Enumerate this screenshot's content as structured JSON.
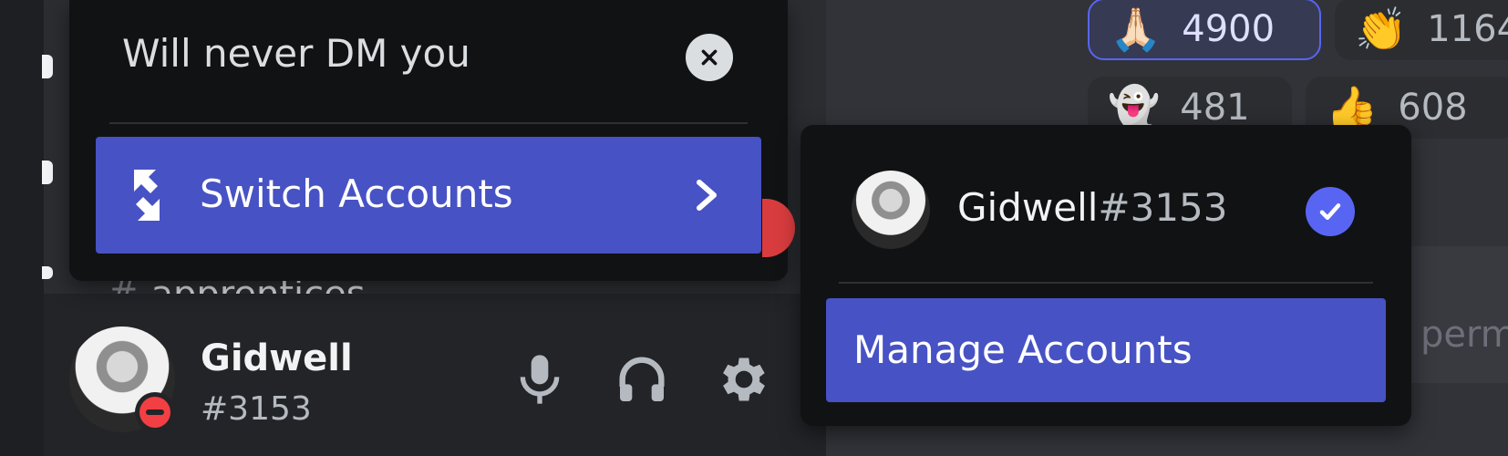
{
  "status_popout": {
    "custom_status": "Will never DM you",
    "switch_accounts_label": "Switch Accounts"
  },
  "channel_list": {
    "partial_channel_name": "apprentices"
  },
  "user_panel": {
    "username": "Gidwell",
    "discriminator": "#3153",
    "status": "do-not-disturb"
  },
  "accounts_popout": {
    "account_username": "Gidwell",
    "account_discriminator": "#3153",
    "manage_accounts_label": "Manage Accounts"
  },
  "reactions": [
    {
      "emoji": "🙏🏻",
      "emoji_name": "folded-hands-icon",
      "count": "4900",
      "active": true
    },
    {
      "emoji": "👏",
      "emoji_name": "clapping-hands-icon",
      "count": "1164",
      "active": false
    },
    {
      "emoji": "👻",
      "emoji_name": "ghost-icon",
      "count": "481",
      "active": false
    },
    {
      "emoji": "👍",
      "emoji_name": "thumbs-up-icon",
      "count": "608",
      "active": false
    }
  ],
  "message_input": {
    "placeholder_fragment": "perm"
  },
  "colors": {
    "blurple": "#5865f2",
    "button_blue": "#4752c4",
    "dnd_red": "#f23f43"
  }
}
